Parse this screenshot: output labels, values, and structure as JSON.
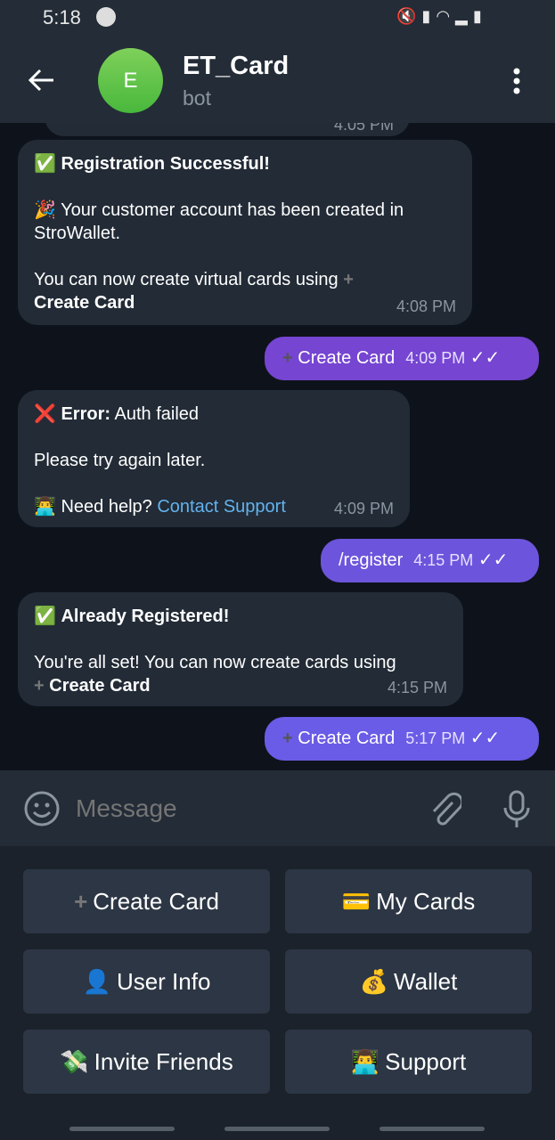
{
  "status_bar": {
    "time": "5:18"
  },
  "header": {
    "avatar_letter": "E",
    "title": "ET_Card",
    "subtitle": "bot"
  },
  "messages": [
    {
      "dir": "in",
      "clipped_time": "4:05 PM"
    },
    {
      "dir": "in",
      "title": "Registration Successful!",
      "line1": "Your customer account has been created in StroWallet.",
      "line2": "You can now create virtual cards using",
      "cmd": "Create Card",
      "time": "4:08 PM"
    },
    {
      "dir": "out",
      "text": "Create Card",
      "time": "4:09 PM"
    },
    {
      "dir": "in",
      "title": "Error:",
      "title_rest": " Auth failed",
      "line1": "Please try again later.",
      "help": "Need help?",
      "link": "Contact Support",
      "time": "4:09 PM"
    },
    {
      "dir": "out",
      "text": "/register",
      "time": "4:15 PM"
    },
    {
      "dir": "in",
      "title": "Already Registered!",
      "line1": "You're all set! You can now create cards using",
      "cmd": "Create Card",
      "time": "4:15 PM"
    },
    {
      "dir": "out",
      "text": "Create Card",
      "time": "5:17 PM"
    }
  ],
  "input": {
    "placeholder": "Message"
  },
  "keyboard": [
    {
      "emoji": "➕",
      "label": "Create Card"
    },
    {
      "emoji": "💳",
      "label": "My Cards"
    },
    {
      "emoji": "👤",
      "label": "User Info"
    },
    {
      "emoji": "💰",
      "label": "Wallet"
    },
    {
      "emoji": "💸",
      "label": "Invite Friends"
    },
    {
      "emoji": "👨‍💻",
      "label": "Support"
    }
  ],
  "colors": {
    "outgoing": "#7645d2",
    "link": "#63b3ee",
    "avatar": "#5cc24a"
  }
}
